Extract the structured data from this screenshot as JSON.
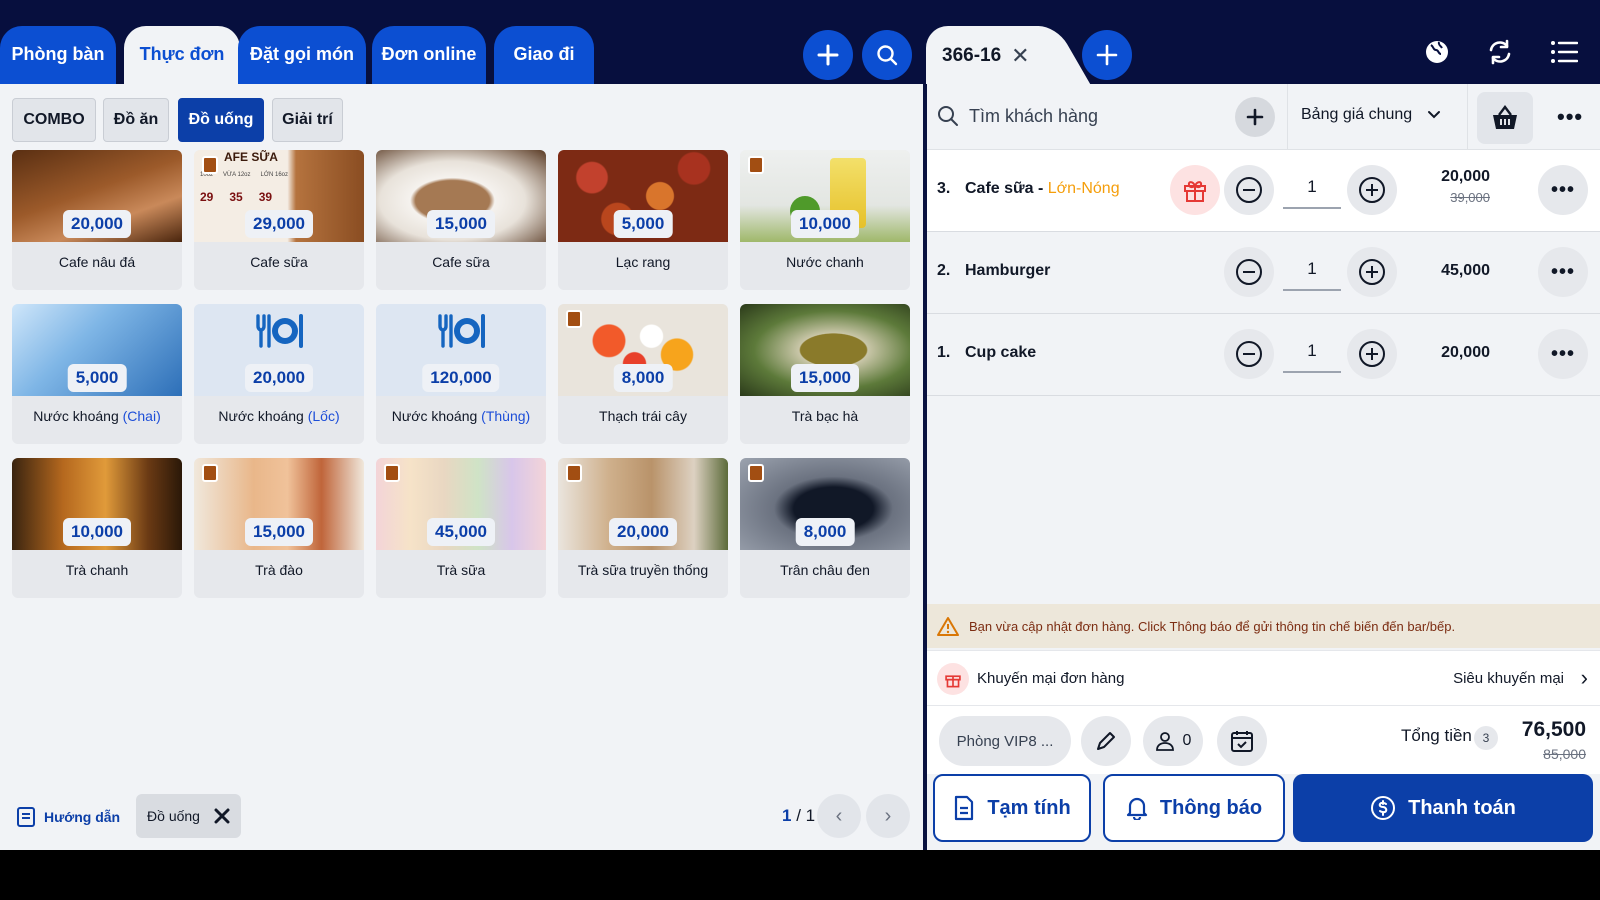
{
  "top_tabs": [
    "Phòng bàn",
    "Thực đơn",
    "Đặt gọi món",
    "Đơn online",
    "Giao đi"
  ],
  "active_tab": "Thực đơn",
  "order_tab": {
    "label": "366-16"
  },
  "categories": [
    "COMBO",
    "Đồ ăn",
    "Đồ uống",
    "Giải trí"
  ],
  "active_category": "Đồ uống",
  "menu_items": [
    {
      "price": "20,000",
      "name": "Cafe nâu đá",
      "variant": ""
    },
    {
      "price": "29,000",
      "name": "Cafe sữa",
      "variant": ""
    },
    {
      "price": "15,000",
      "name": "Cafe sữa",
      "variant": ""
    },
    {
      "price": "5,000",
      "name": "Lạc rang",
      "variant": ""
    },
    {
      "price": "10,000",
      "name": "Nước chanh",
      "variant": ""
    },
    {
      "price": "5,000",
      "name": "Nước khoáng",
      "variant": "(Chai)"
    },
    {
      "price": "20,000",
      "name": "Nước khoáng",
      "variant": "(Lốc)"
    },
    {
      "price": "120,000",
      "name": "Nước khoáng",
      "variant": "(Thùng)"
    },
    {
      "price": "8,000",
      "name": "Thạch trái cây",
      "variant": ""
    },
    {
      "price": "15,000",
      "name": "Trà bạc hà",
      "variant": ""
    },
    {
      "price": "10,000",
      "name": "Trà chanh",
      "variant": ""
    },
    {
      "price": "15,000",
      "name": "Trà đào",
      "variant": ""
    },
    {
      "price": "45,000",
      "name": "Trà sữa",
      "variant": ""
    },
    {
      "price": "20,000",
      "name": "Trà sữa truyền thống",
      "variant": ""
    },
    {
      "price": "8,000",
      "name": "Trân châu đen",
      "variant": ""
    }
  ],
  "card2_image_text": {
    "title": "AFE SỮA",
    "sizes": [
      "10oz",
      "VỪA 12oz",
      "LỚN 16oz"
    ],
    "prices": [
      "29",
      "35",
      "39"
    ]
  },
  "footer_left": {
    "guide": "Hướng dẫn",
    "filter_chip": "Đồ uống",
    "page_current": "1",
    "page_total": "/ 1"
  },
  "customer": {
    "placeholder": "Tìm khách hàng",
    "price_list": "Bảng giá chung"
  },
  "order_items": [
    {
      "index": "3.",
      "name": "Cafe sữa - ",
      "variant": "Lớn-Nóng",
      "qty": "1",
      "amount": "20,000",
      "old_amount": "39,000"
    },
    {
      "index": "2.",
      "name": "Hamburger",
      "variant": "",
      "qty": "1",
      "amount": "45,000",
      "old_amount": ""
    },
    {
      "index": "1.",
      "name": "Cup cake",
      "variant": "",
      "qty": "1",
      "amount": "20,000",
      "old_amount": ""
    }
  ],
  "warning": "Bạn vừa cập nhật đơn hàng. Click Thông báo để gửi thông tin chế biến đến bar/bếp.",
  "promo": {
    "label": "Khuyến mại đơn hàng",
    "link": "Siêu khuyến mại"
  },
  "summary": {
    "room": "Phòng VIP8 ...",
    "guests": "0",
    "total_label": "Tổng tiền",
    "item_count": "3",
    "total": "76,500",
    "old_total": "85,000"
  },
  "actions": {
    "temp": "Tạm tính",
    "notify": "Thông báo",
    "pay": "Thanh toán"
  },
  "colors": {
    "primary": "#0c3fa8",
    "tab_blue": "#0c4fd2",
    "topbar": "#070f3e",
    "accent_orange": "#f59e0b"
  }
}
